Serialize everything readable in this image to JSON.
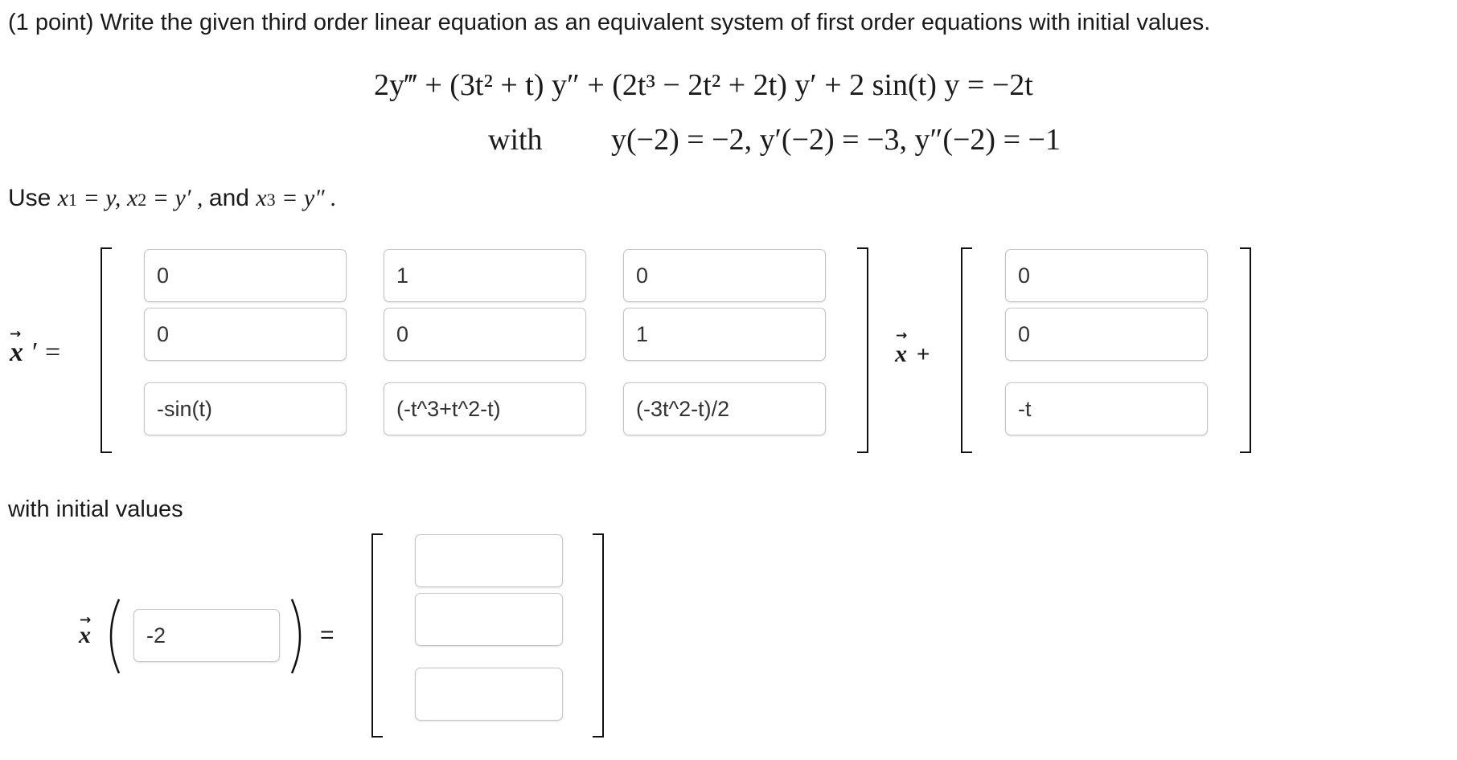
{
  "question": "(1 point) Write the given third order linear equation as an equivalent system of first order equations with initial values.",
  "equation": {
    "main": "2y‴ + (3t² + t) y″ + (2t³ − 2t² + 2t) y′ + 2 sin(t) y = −2t",
    "with_word": "with",
    "conditions": "y(−2) = −2,  y′(−2) = −3,  y″(−2) = −1"
  },
  "use": {
    "lead": "Use",
    "x1": "x",
    "sub1": "1",
    "eq1": " = y, ",
    "x2": "x",
    "sub2": "2",
    "eq2": " = y′ , ",
    "and": "and",
    "x3": "x",
    "sub3": "3",
    "eq3": " = y″ ."
  },
  "system": {
    "lhs_var": "x",
    "prime_eq": "′ =",
    "middle_var": "x",
    "plus": "+",
    "matrix": [
      [
        "0",
        "1",
        "0"
      ],
      [
        "0",
        "0",
        "1"
      ],
      [
        "-sin(t)",
        "(-t^3+t^2-t)",
        "(-3t^2-t)/2"
      ]
    ],
    "forcing": [
      "0",
      "0",
      "-t"
    ]
  },
  "initial": {
    "label": "with initial values",
    "var": "x",
    "t0": "-2",
    "equals": "=",
    "values": [
      "",
      "",
      ""
    ]
  },
  "icons": {
    "vector_arrow": "→"
  }
}
